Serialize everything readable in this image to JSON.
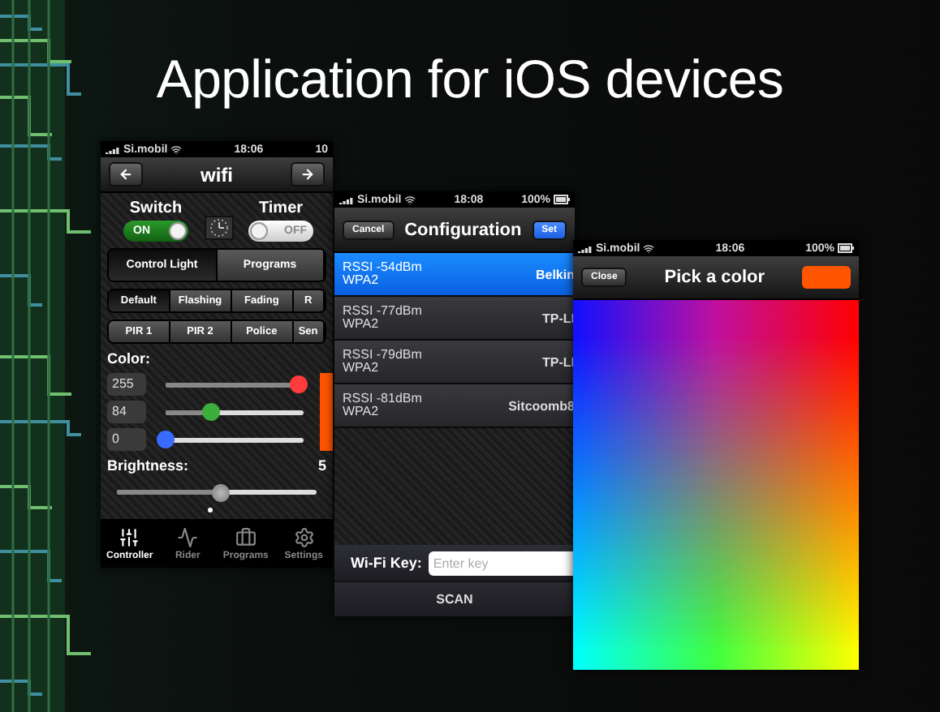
{
  "slide_title": "Application for iOS devices",
  "controller_screen": {
    "status_bar": {
      "carrier": "Si.mobil",
      "time": "18:06",
      "battery": "10"
    },
    "title": "wifi",
    "switches": [
      {
        "label": "Switch",
        "on": true,
        "state_label": "ON"
      },
      {
        "label": "Timer",
        "on": false,
        "state_label": "OFF"
      }
    ],
    "segments": [
      {
        "label": "Control Light",
        "selected": true
      },
      {
        "label": "Programs",
        "selected": false
      }
    ],
    "mode_rows": [
      [
        {
          "label": "Default",
          "selected": true
        },
        {
          "label": "Flashing",
          "selected": false
        },
        {
          "label": "Fading",
          "selected": false
        },
        {
          "label": "R",
          "selected": false
        }
      ],
      [
        {
          "label": "PIR 1",
          "selected": false
        },
        {
          "label": "PIR 2",
          "selected": false
        },
        {
          "label": "Police",
          "selected": false
        },
        {
          "label": "Sen",
          "selected": false
        }
      ]
    ],
    "color_label": "Color:",
    "channels": [
      {
        "value": "255",
        "level": 0.97,
        "color": "#ff3b3b"
      },
      {
        "value": "84",
        "level": 0.33,
        "color": "#3cae3c"
      },
      {
        "value": "0",
        "level": 0,
        "color": "#3a6bff"
      }
    ],
    "brightness": {
      "label": "Brightness:",
      "reading": "5",
      "level": 0.52
    },
    "tabs": [
      {
        "label": "Controller",
        "selected": true
      },
      {
        "label": "Rider",
        "selected": false
      },
      {
        "label": "Programs",
        "selected": false
      },
      {
        "label": "Settings",
        "selected": false
      }
    ]
  },
  "configuration_screen": {
    "status_bar": {
      "carrier": "Si.mobil",
      "time": "18:08",
      "battery": "100%"
    },
    "title": "Configuration",
    "cancel": "Cancel",
    "set": "Set",
    "networks": [
      {
        "rssi": "RSSI -54dBm",
        "security": "WPA2",
        "name": "Belkin",
        "selected": true
      },
      {
        "rssi": "RSSI -77dBm",
        "security": "WPA2",
        "name": "TP-LI",
        "selected": false
      },
      {
        "rssi": "RSSI -79dBm",
        "security": "WPA2",
        "name": "TP-LI",
        "selected": false
      },
      {
        "rssi": "RSSI -81dBm",
        "security": "WPA2",
        "name": "Sitcoomb8",
        "selected": false
      }
    ],
    "key_label": "Wi-Fi Key:",
    "key_placeholder": "Enter key",
    "scan": "SCAN"
  },
  "color_picker_screen": {
    "status_bar": {
      "carrier": "Si.mobil",
      "time": "18:06",
      "battery": "100%"
    },
    "close": "Close",
    "title": "Pick a color"
  }
}
